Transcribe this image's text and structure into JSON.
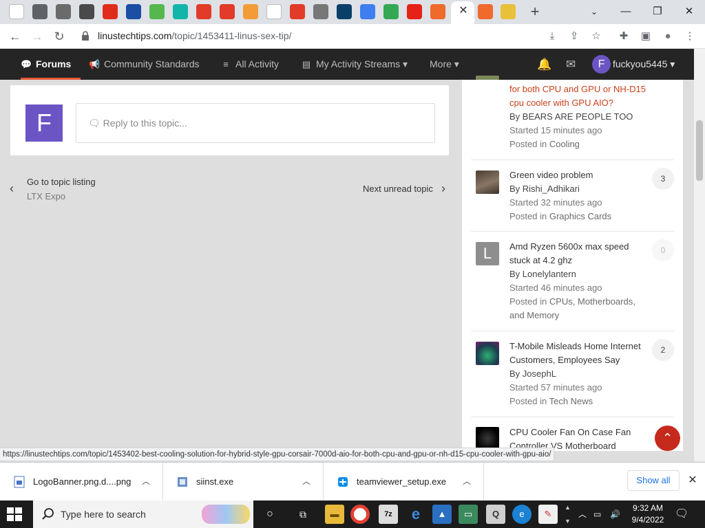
{
  "browser": {
    "active_tab_close": "✕",
    "url_host": "linustechtips.com",
    "url_path": "/topic/1453411-linus-sex-tip/",
    "new_tab": "+",
    "status_url": "https://linustechtips.com/topic/1453402-best-cooling-solution-for-hybrid-style-gpu-corsair-7000d-aio-for-both-cpu-and-gpu-or-nh-d15-cpu-cooler-with-gpu-aio/",
    "tab_icons": [
      "google-icon",
      "chrome-icon",
      "app-icon",
      "shield-icon",
      "adobe-icon",
      "circle-icon",
      "recycle-icon",
      "circle-icon",
      "brave-icon",
      "brave-icon",
      "app-icon",
      "google-icon",
      "brave-icon",
      "chrome-icon",
      "app-icon",
      "app-icon",
      "play-icon",
      "youtube-icon",
      "ltt-icon",
      "ltt-icon",
      "app-icon"
    ]
  },
  "forum_nav": {
    "forums": "Forums",
    "community_standards": "Community Standards",
    "all_activity": "All Activity",
    "activity_streams": "My Activity Streams",
    "more": "More",
    "username": "fuckyou5445",
    "avatar_letter": "F"
  },
  "main": {
    "avatar_letter": "F",
    "reply_placeholder": "Reply to this topic...",
    "prev_label": "Go to topic listing",
    "prev_sub": "LTX Expo",
    "next_label": "Next unread topic"
  },
  "sidebar": {
    "items": [
      {
        "title": "for both CPU and GPU or NH-D15 cpu cooler with GPU AIO?",
        "by": "By BEARS ARE PEOPLE TOO",
        "started": "Started 15 minutes ago",
        "posted_prefix": "Posted in ",
        "posted_in": "Cooling"
      },
      {
        "title": "Green video problem",
        "by": "By Rishi_Adhikari",
        "started": "Started 32 minutes ago",
        "posted_prefix": "Posted in ",
        "posted_in": "Graphics Cards",
        "count": "3"
      },
      {
        "title": "Amd Ryzen 5600x max speed stuck at 4.2 ghz",
        "by": "By Lonelylantern",
        "started": "Started 46 minutes ago",
        "posted_prefix": "Posted in ",
        "posted_in": "CPUs, Motherboards, and Memory",
        "count": "0",
        "avatar_letter": "L"
      },
      {
        "title": "T-Mobile Misleads Home Internet Customers, Employees Say",
        "by": "By JosephL",
        "started": "Started 57 minutes ago",
        "posted_prefix": "Posted in ",
        "posted_in": "Tech News",
        "count": "2"
      },
      {
        "title": "CPU Cooler Fan On Case Fan Controller VS Motherboard"
      }
    ]
  },
  "downloads": {
    "items": [
      {
        "name": "LogoBanner.png.d....png"
      },
      {
        "name": "siinst.exe"
      },
      {
        "name": "teamviewer_setup.exe"
      }
    ],
    "show_all": "Show all"
  },
  "taskbar": {
    "search_placeholder": "Type here to search",
    "time": "9:32 AM",
    "date": "9/4/2022"
  }
}
